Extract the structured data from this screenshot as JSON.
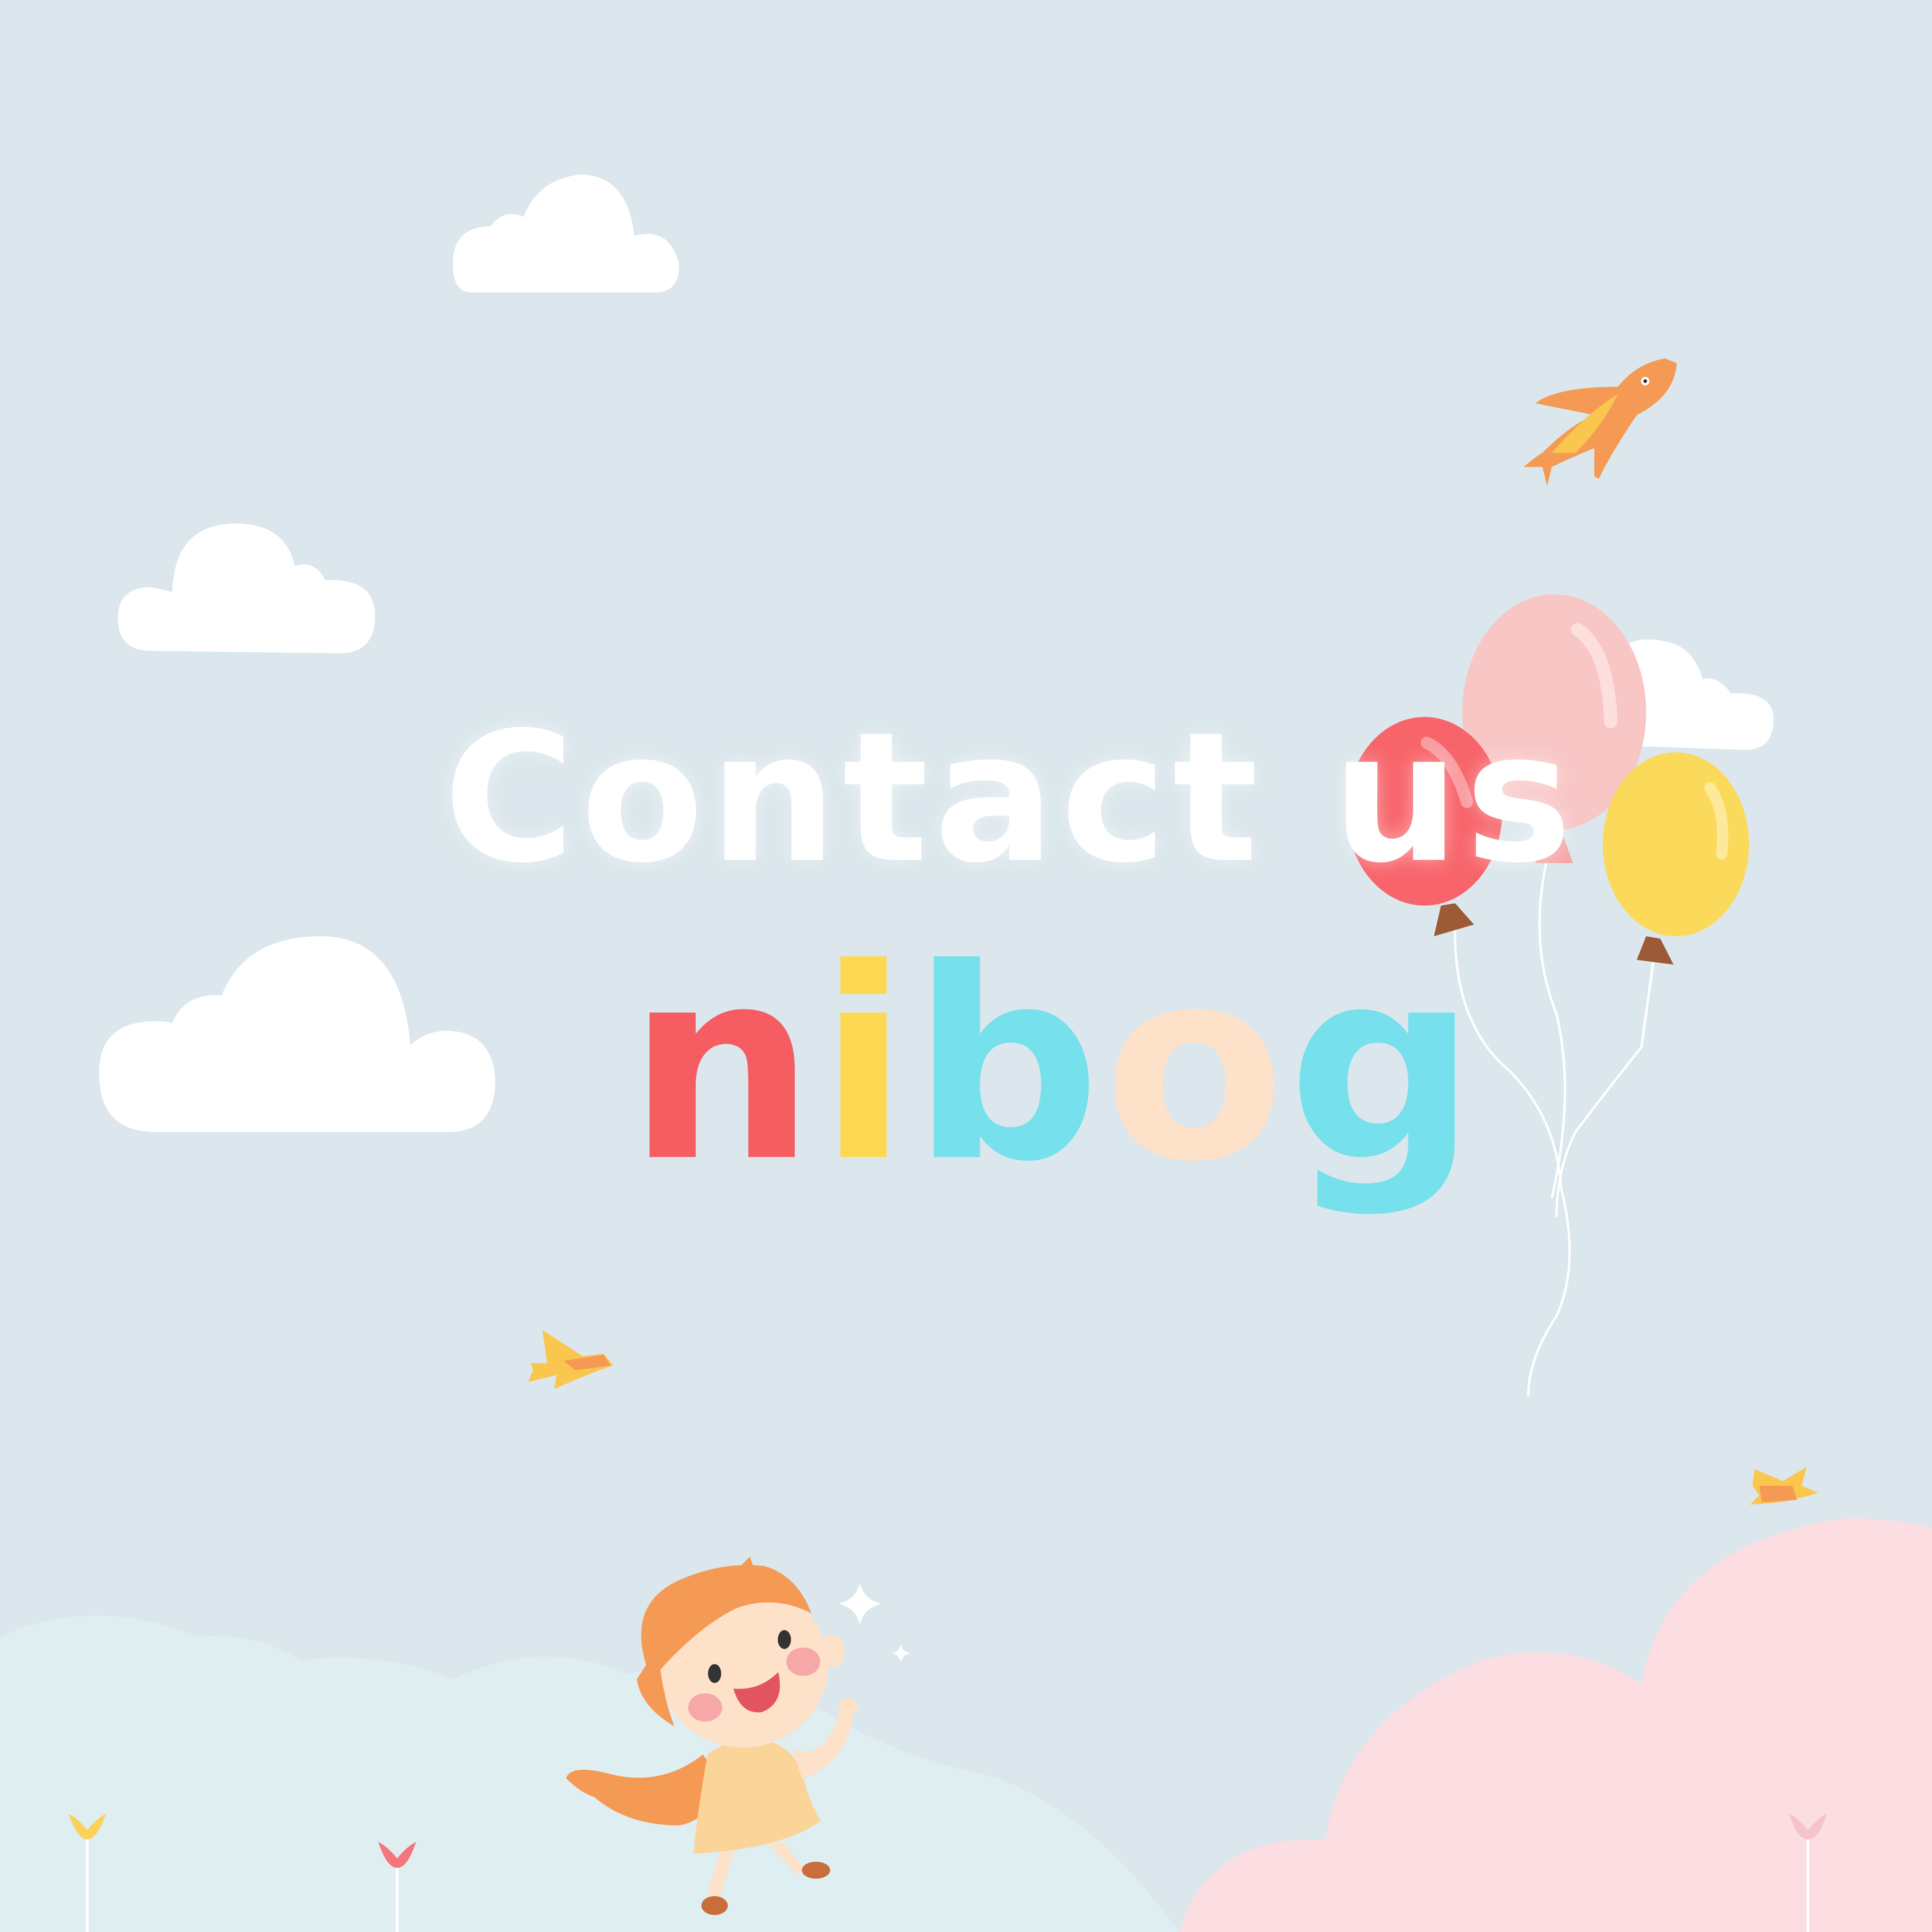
{
  "heading": "Contact us",
  "logo": {
    "letters": [
      "n",
      "i",
      "b",
      "o",
      "g"
    ],
    "colors": [
      "#f65d63",
      "#fdd951",
      "#76e0ec",
      "#fde1c8",
      "#76e0ec"
    ]
  },
  "colors": {
    "sky": "#dbe7ec",
    "cloud": "#ffffff",
    "balloon_red": "#f7656b",
    "balloon_pink": "#f9c6c6",
    "balloon_yellow": "#fbd95a",
    "bird_orange": "#f59a54",
    "hill_pink": "#fbdde2",
    "hill_blue": "#dfeef1"
  },
  "icons": [
    "cloud-icon",
    "balloon-icon",
    "bird-icon",
    "sparkle-icon",
    "flower-icon",
    "child-illustration"
  ]
}
